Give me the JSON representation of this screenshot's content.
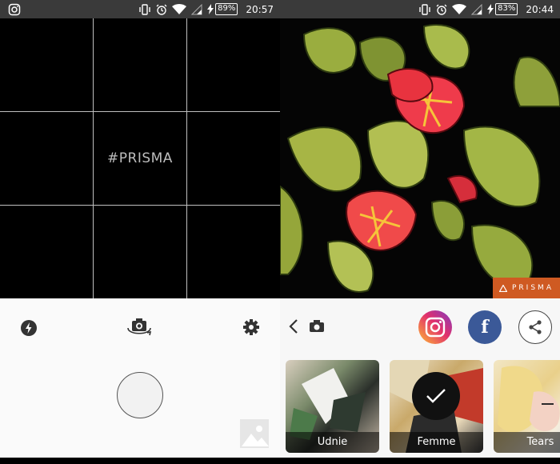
{
  "left": {
    "status": {
      "battery": "89%",
      "time": "20:57"
    },
    "viewfinder": {
      "watermark": "#PRISMA"
    }
  },
  "right": {
    "status": {
      "battery": "83%",
      "time": "20:44"
    },
    "artwork": {
      "badge": "PRISMA"
    },
    "share": {
      "facebook_glyph": "f"
    },
    "filters": [
      {
        "label": "Udnie",
        "selected": false
      },
      {
        "label": "Femme",
        "selected": true
      },
      {
        "label": "Tears",
        "selected": false
      }
    ]
  },
  "colors": {
    "badge": "#cf5a22",
    "facebook": "#3b5998",
    "status_bar": "#3a3a3a"
  }
}
